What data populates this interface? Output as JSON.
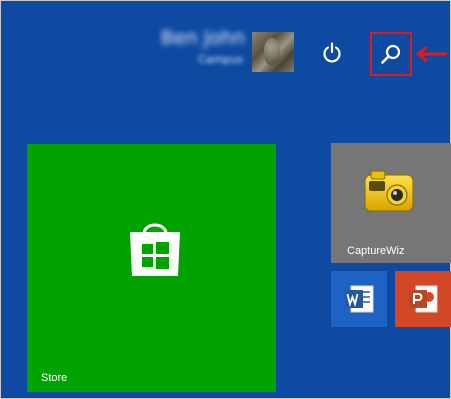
{
  "user": {
    "name": "Ben John",
    "account": "Campus"
  },
  "header": {
    "power_icon": "power-icon",
    "search_icon": "search-icon",
    "highlight_color": "#e0191f"
  },
  "tiles": {
    "store": {
      "label": "Store",
      "color": "#00a300",
      "icon": "shopping-bag-windows-icon"
    },
    "capturewiz": {
      "label": "CaptureWiz",
      "color": "#767676",
      "icon": "camera-icon"
    },
    "word": {
      "color": "#1e62c3",
      "icon": "word-icon"
    },
    "powerpoint": {
      "color": "#d24726",
      "icon": "powerpoint-icon"
    }
  },
  "background_color": "#0e4aa2"
}
